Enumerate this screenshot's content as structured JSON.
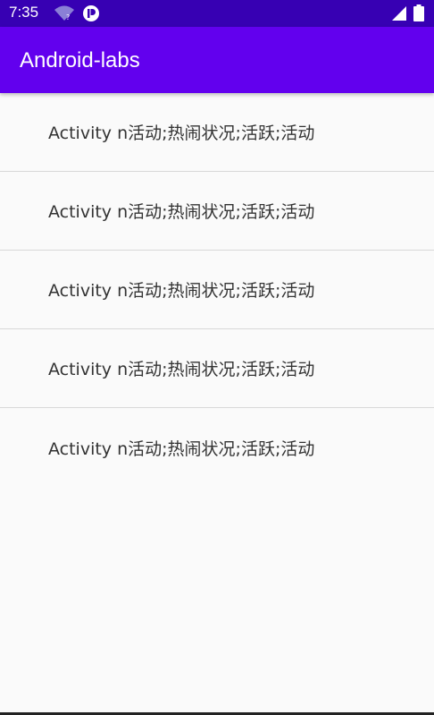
{
  "status_bar": {
    "time": "7:35",
    "icons": [
      "wifi-unknown-icon",
      "app-notification-icon",
      "signal-icon",
      "battery-icon"
    ]
  },
  "app_bar": {
    "title": "Android-labs",
    "color": "#6200ee"
  },
  "list": {
    "items": [
      {
        "label": "Activity n活动;热闹状况;活跃;活动"
      },
      {
        "label": "Activity n活动;热闹状况;活跃;活动"
      },
      {
        "label": "Activity n活动;热闹状况;活跃;活动"
      },
      {
        "label": "Activity n活动;热闹状况;活跃;活动"
      },
      {
        "label": "Activity n活动;热闹状况;活跃;活动"
      }
    ]
  }
}
